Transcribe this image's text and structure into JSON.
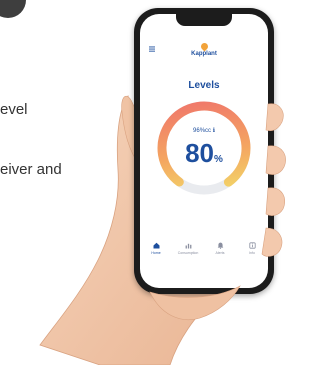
{
  "caption": {
    "lines": [
      "evel",
      "eiver and"
    ]
  },
  "app": {
    "logo_text": "Kapplant",
    "screen_title": "Levels",
    "gauge": {
      "sub_label": "96%cc ℹ",
      "value": "80",
      "unit": "%",
      "percent": 80
    },
    "nav": [
      {
        "label": "Home"
      },
      {
        "label": "Consumption"
      },
      {
        "label": "Alerts"
      },
      {
        "label": "Info"
      }
    ]
  },
  "colors": {
    "brand_blue": "#1e4f9e",
    "gauge_yellow": "#f2e46a",
    "gauge_orange": "#f4a661",
    "gauge_red": "#ef6e6c",
    "gauge_track": "#e9ebef",
    "phone_frame": "#1c1c1c",
    "skin": "#f3c9ad"
  },
  "icons": {
    "menu": "hamburger-icon",
    "logo": "droplet-icon",
    "nav": [
      "home-icon",
      "chart-icon",
      "bell-icon",
      "info-icon"
    ]
  }
}
